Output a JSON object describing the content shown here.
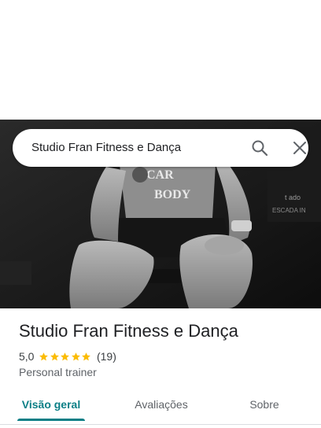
{
  "search": {
    "query": "Studio Fran Fitness e Dança"
  },
  "hero": {
    "shirt_text_line1": "CAR",
    "shirt_text_line2": "BODY",
    "sign_text_line1": "t ado",
    "sign_text_line2": "ESCADA IN"
  },
  "place": {
    "title": "Studio Fran Fitness e Dança",
    "rating": "5,0",
    "stars": 5,
    "review_count": "(19)",
    "category": "Personal trainer"
  },
  "tabs": [
    {
      "label": "Visão geral",
      "active": true
    },
    {
      "label": "Avaliações",
      "active": false
    },
    {
      "label": "Sobre",
      "active": false
    }
  ],
  "colors": {
    "accent": "#0b7f86",
    "star": "#fbbc04"
  }
}
